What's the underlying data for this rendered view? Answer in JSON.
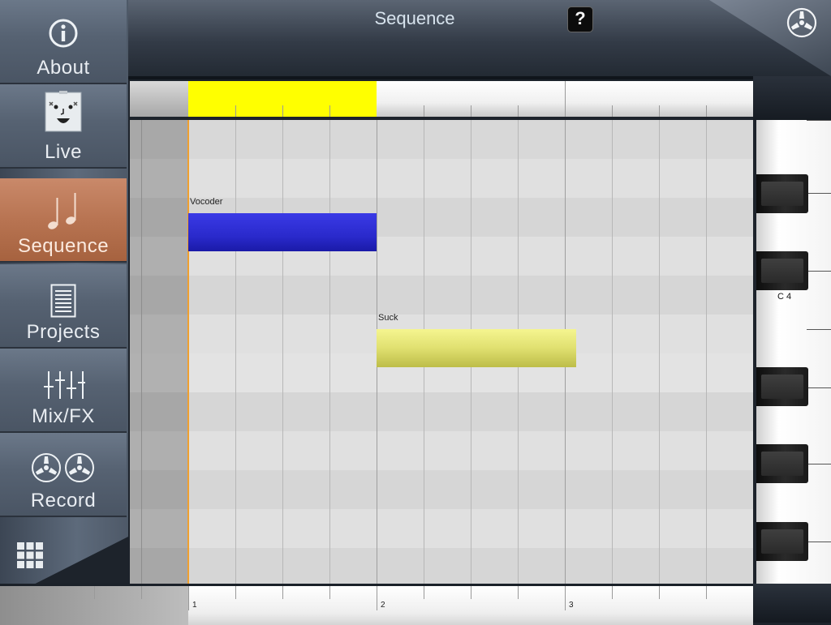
{
  "sidebar": {
    "items": [
      {
        "label": "About",
        "icon": "info-icon",
        "active": false
      },
      {
        "label": "Live",
        "icon": "face-icon",
        "active": false
      },
      {
        "label": "Sequence",
        "icon": "music-notes-icon",
        "active": true
      },
      {
        "label": "Projects",
        "icon": "document-icon",
        "active": false
      },
      {
        "label": "Mix/FX",
        "icon": "faders-icon",
        "active": false
      },
      {
        "label": "Record",
        "icon": "reels-icon",
        "active": false
      }
    ],
    "grid_icon": "grid-icon"
  },
  "header": {
    "title": "Sequence",
    "help_label": "?",
    "record_icon": "reel-icon"
  },
  "sequence": {
    "notes": [
      {
        "name": "Vocoder",
        "color": "#2a2acc"
      },
      {
        "name": "Suck",
        "color": "#e0e070"
      }
    ],
    "loop_color": "#ffff00",
    "playhead_color": "#f0a030",
    "bar_numbers": [
      "1",
      "2",
      "3"
    ],
    "key_label": "C 4"
  }
}
